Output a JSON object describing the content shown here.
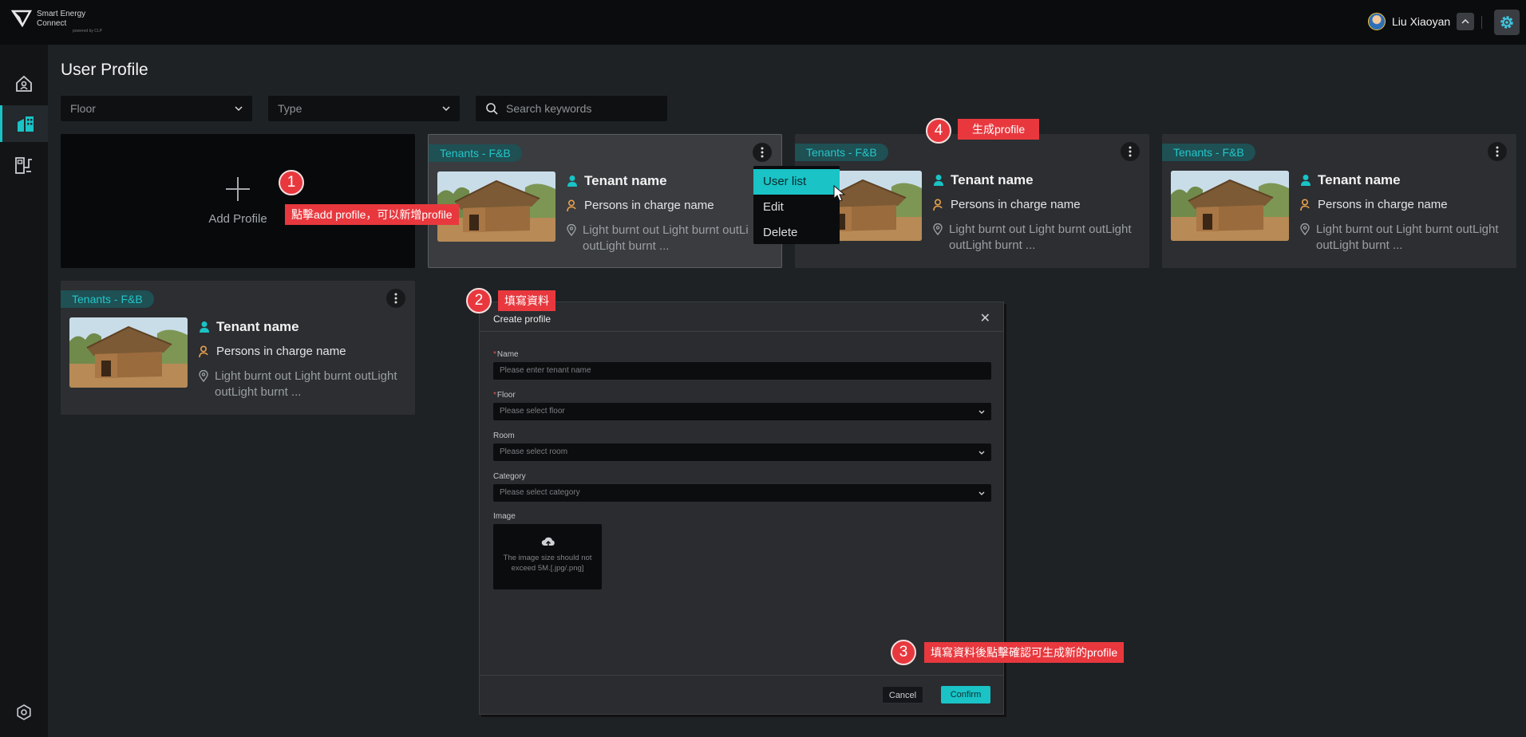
{
  "header": {
    "brand_line1": "Smart Energy",
    "brand_line2": "Connect",
    "brand_sub": "powered by CLP",
    "user_name": "Liu Xiaoyan"
  },
  "sidebar": {
    "items": [
      {
        "icon": "home-icon",
        "active": false
      },
      {
        "icon": "building-icon",
        "active": true
      },
      {
        "icon": "energy-meter-icon",
        "active": false
      }
    ],
    "bottom_icon": "settings-icon"
  },
  "page": {
    "title": "User Profile",
    "filters": {
      "floor_placeholder": "Floor",
      "type_placeholder": "Type",
      "search_placeholder": "Search keywords"
    },
    "add_profile_label": "Add Profile"
  },
  "cards": [
    {
      "tag": "Tenants - F&B",
      "tenant": "Tenant name",
      "person": "Persons in charge name",
      "address": "Light burnt out Light burnt outLight burnt outLight burnt ...",
      "address_line1": "Light burnt out Light burnt outLi",
      "address_line2": "outLight burnt ..."
    },
    {
      "tag": "Tenants - F&B",
      "tenant": "Tenant name",
      "person": "Persons in charge name",
      "address_line1": "Light burnt out Light burnt outLight",
      "address_line2": "outLight burnt ..."
    },
    {
      "tag": "Tenants - F&B",
      "tenant": "Tenant name",
      "person": "Persons in charge name",
      "address_line1": "Light burnt out Light burnt outLight",
      "address_line2": "outLight burnt ..."
    },
    {
      "tag": "Tenants - F&B",
      "tenant": "Tenant name",
      "person": "Persons in charge name",
      "address_line1": "Light burnt out Light burnt outLight",
      "address_line2": "outLight burnt ..."
    }
  ],
  "context_menu": {
    "items": [
      "User list",
      "Edit",
      "Delete"
    ],
    "selected": "User list"
  },
  "modal": {
    "title": "Create profile",
    "fields": {
      "name_label": "Name",
      "name_placeholder": "Please enter tenant name",
      "floor_label": "Floor",
      "floor_placeholder": "Please select floor",
      "room_label": "Room",
      "room_placeholder": "Please select room",
      "category_label": "Category",
      "category_placeholder": "Please select category",
      "image_label": "Image",
      "image_hint": "The image size should not exceed 5M.[.jpg/.png]"
    },
    "cancel_label": "Cancel",
    "confirm_label": "Confirm"
  },
  "annotations": [
    {
      "num": "1",
      "text": "點擊add profile，可以新增profile"
    },
    {
      "num": "2",
      "text": "填寫資料"
    },
    {
      "num": "3",
      "text": "填寫資料後點擊確認可生成新的profile"
    },
    {
      "num": "4",
      "text": "生成profile"
    }
  ],
  "colors": {
    "accent": "#19c3c6",
    "tag_bg": "#1e5054",
    "person_icon": "#e8a04c",
    "annotation": "#e8383e"
  }
}
